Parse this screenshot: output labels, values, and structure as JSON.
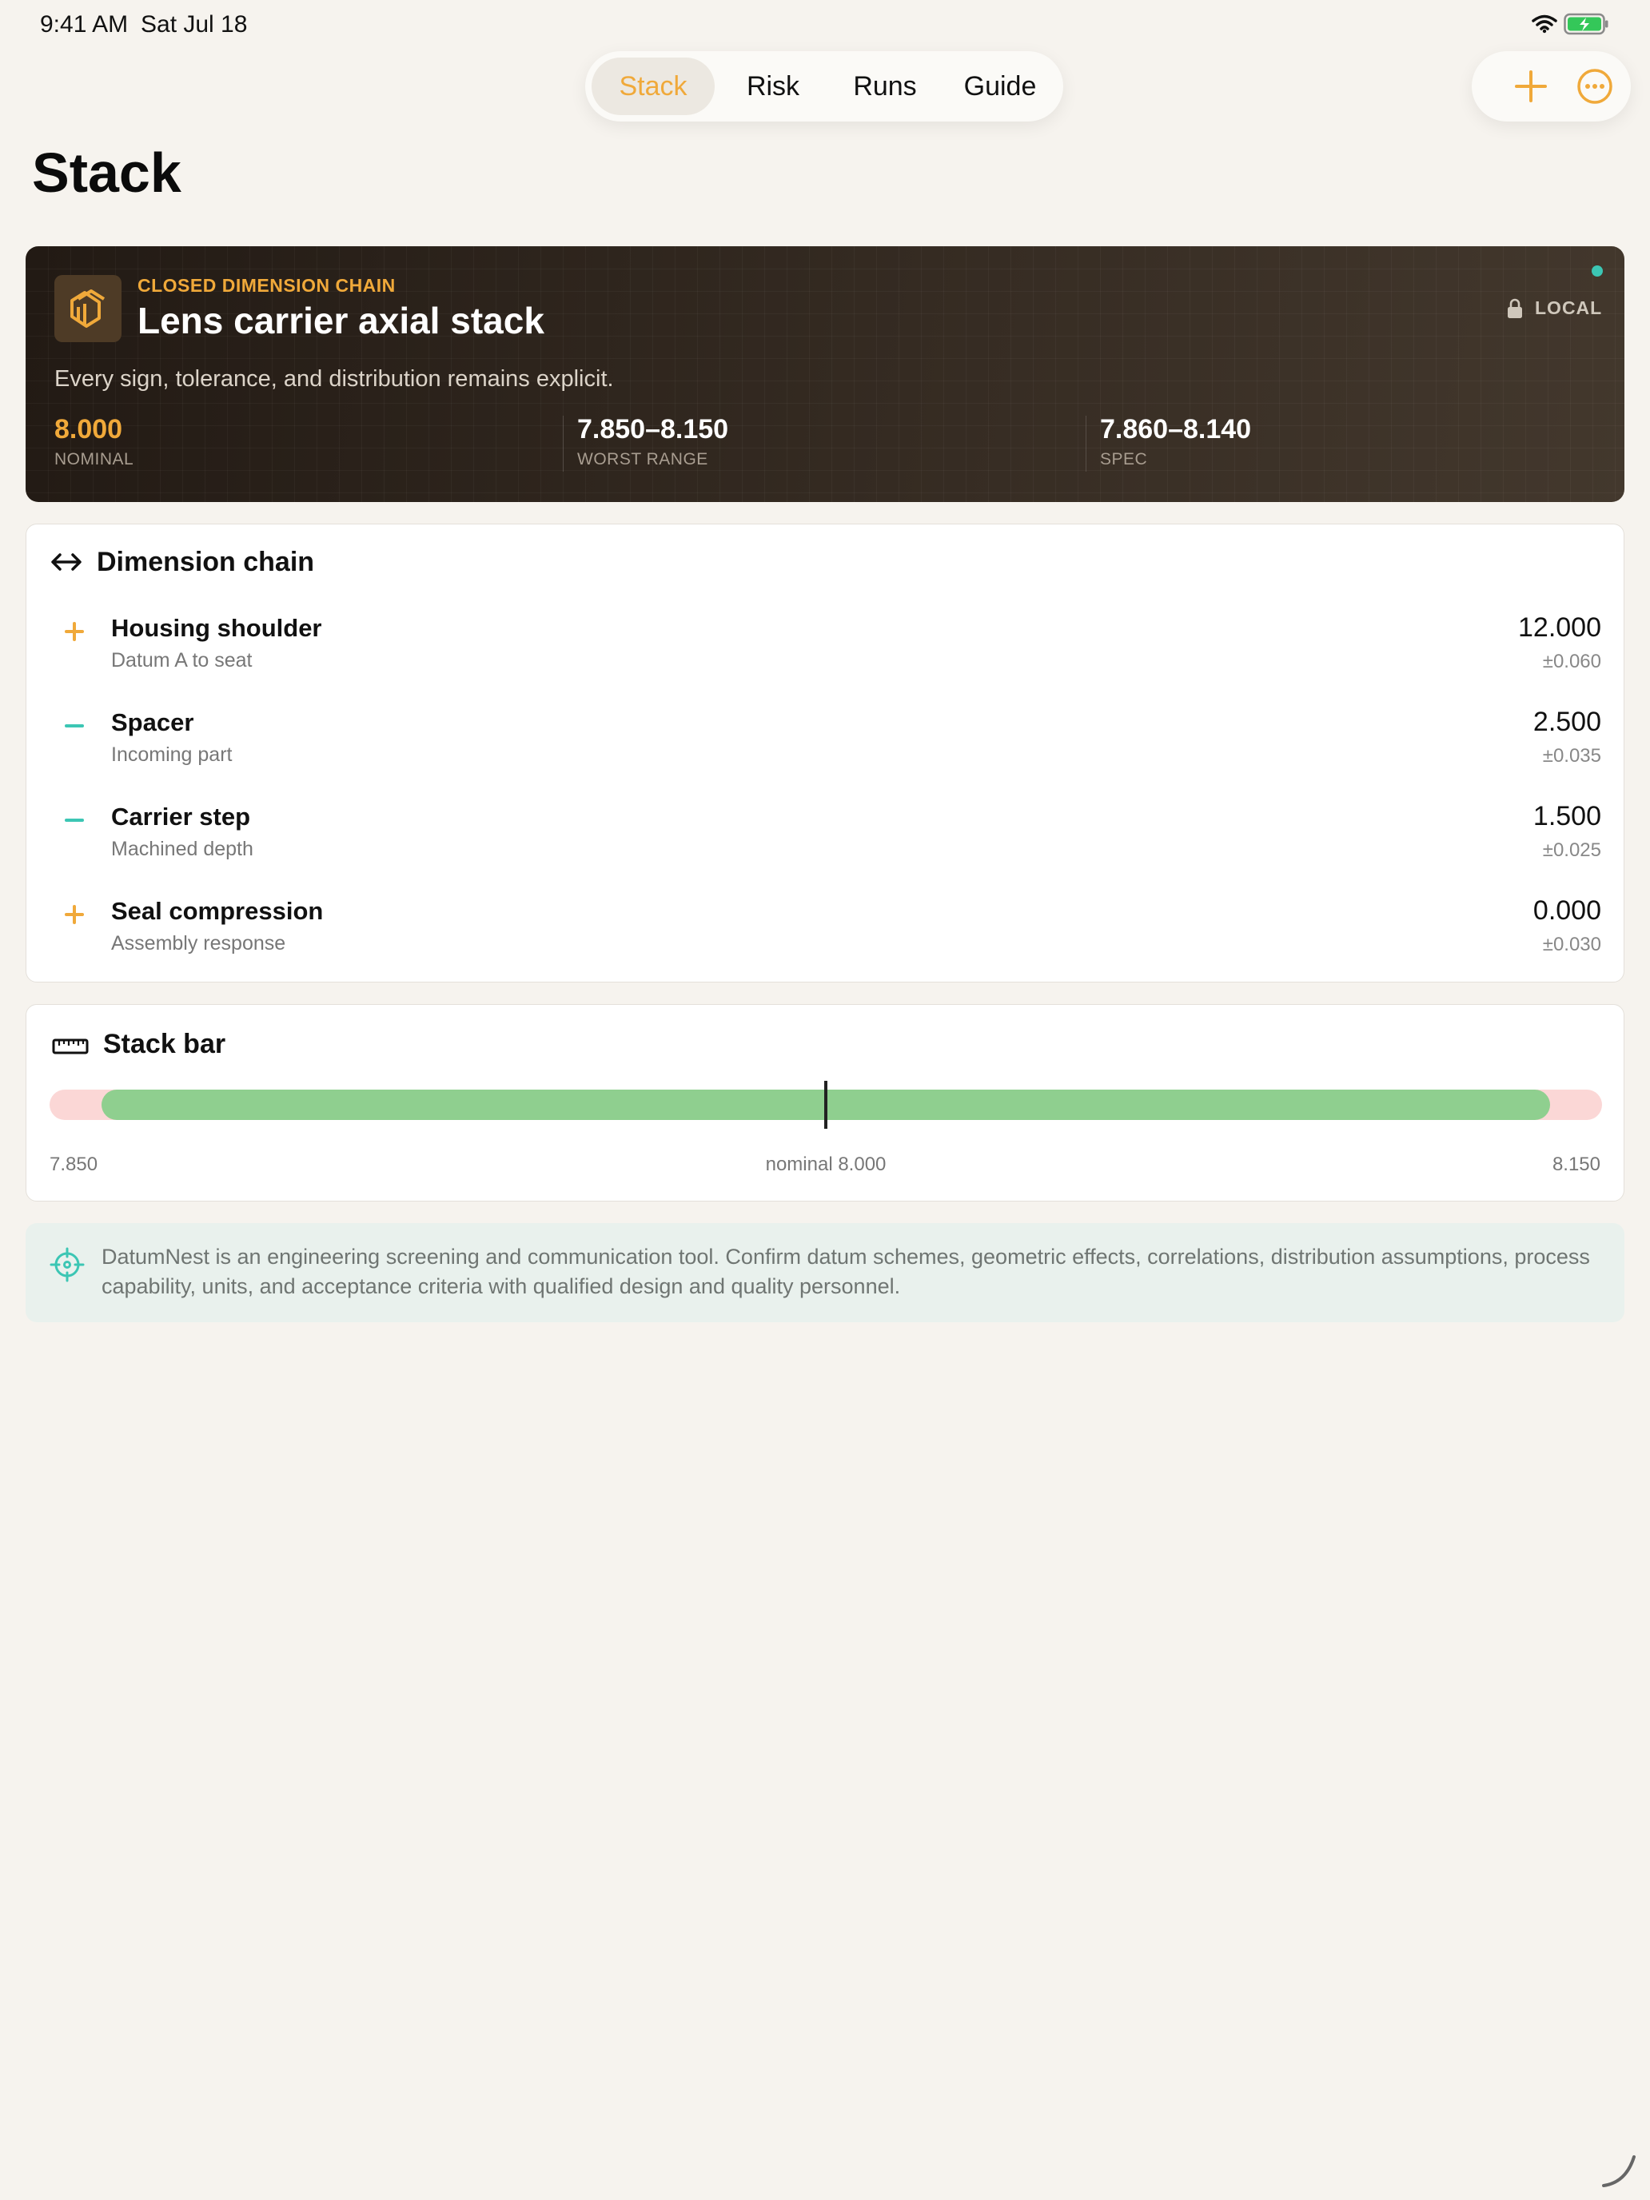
{
  "status_bar": {
    "time": "9:41 AM",
    "date": "Sat Jul 18"
  },
  "tabs": [
    {
      "label": "Stack",
      "active": true
    },
    {
      "label": "Risk",
      "active": false
    },
    {
      "label": "Runs",
      "active": false
    },
    {
      "label": "Guide",
      "active": false
    }
  ],
  "page": {
    "title": "Stack"
  },
  "hero": {
    "eyebrow": "CLOSED DIMENSION CHAIN",
    "title": "Lens carrier axial stack",
    "description": "Every sign, tolerance, and distribution remains explicit.",
    "badge": "LOCAL",
    "metrics": [
      {
        "value": "8.000",
        "label": "NOMINAL"
      },
      {
        "value": "7.850–8.150",
        "label": "WORST RANGE"
      },
      {
        "value": "7.860–8.140",
        "label": "SPEC"
      }
    ]
  },
  "chain": {
    "title": "Dimension chain",
    "rows": [
      {
        "sign": "+",
        "name": "Housing shoulder",
        "sub": "Datum A to seat",
        "value": "12.000",
        "tol": "±0.060"
      },
      {
        "sign": "−",
        "name": "Spacer",
        "sub": "Incoming part",
        "value": "2.500",
        "tol": "±0.035"
      },
      {
        "sign": "−",
        "name": "Carrier step",
        "sub": "Machined depth",
        "value": "1.500",
        "tol": "±0.025"
      },
      {
        "sign": "+",
        "name": "Seal compression",
        "sub": "Assembly response",
        "value": "0.000",
        "tol": "±0.030"
      }
    ]
  },
  "stack_bar": {
    "title": "Stack bar",
    "min_label": "7.850",
    "center_label": "nominal 8.000",
    "max_label": "8.150",
    "range_min": 7.85,
    "range_max": 8.15,
    "spec_min": 7.86,
    "spec_max": 8.14,
    "nominal": 8.0
  },
  "note": {
    "text": "DatumNest is an engineering screening and communication tool. Confirm datum schemes, geometric effects, correlations, distribution assumptions, process capability, units, and acceptance criteria with qualified design and quality personnel."
  },
  "colors": {
    "accent": "#f0a93a",
    "teal": "#3cc6b4",
    "spec_green": "#8fcf8f",
    "out_of_spec": "#fbd7d6"
  }
}
